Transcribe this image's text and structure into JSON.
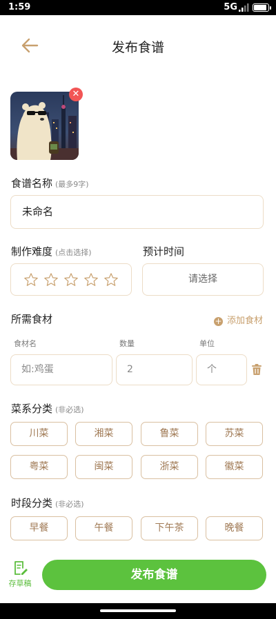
{
  "status": {
    "time": "1:59",
    "network": "5G"
  },
  "header": {
    "title": "发布食谱"
  },
  "recipe_name": {
    "label": "食谱名称",
    "hint": "(最多9字)",
    "value": "未命名"
  },
  "difficulty": {
    "label": "制作难度",
    "hint": "(点击选择)",
    "rating": 0,
    "max": 5
  },
  "time": {
    "label": "预计时间",
    "placeholder": "请选择"
  },
  "ingredients": {
    "label": "所需食材",
    "add_label": "添加食材",
    "col_name": "食材名",
    "col_qty": "数量",
    "col_unit": "单位",
    "row": {
      "name_placeholder": "如:鸡蛋",
      "qty": "2",
      "unit": "个"
    }
  },
  "cuisine": {
    "label": "菜系分类",
    "hint": "(非必选)",
    "options": [
      "川菜",
      "湘菜",
      "鲁菜",
      "苏菜",
      "粤菜",
      "闽菜",
      "浙菜",
      "徽菜"
    ]
  },
  "meal": {
    "label": "时段分类",
    "hint": "(非必选)",
    "options": [
      "早餐",
      "午餐",
      "下午茶",
      "晚餐"
    ]
  },
  "bottom": {
    "draft_label": "存草稿",
    "publish_label": "发布食谱"
  },
  "colors": {
    "accent": "#c8a06e",
    "green": "#5cc23e",
    "delete": "#f25555",
    "border": "#ecdcc6"
  }
}
